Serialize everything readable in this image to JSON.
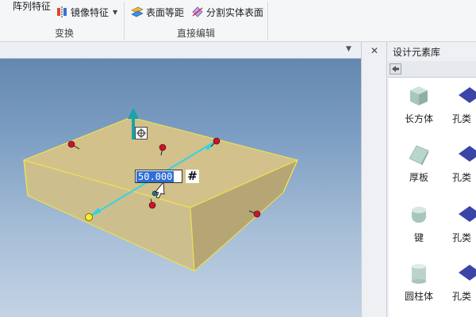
{
  "ribbon": {
    "transform_group": {
      "pattern_feature_label": "阵列特征",
      "mirror_feature_label": "镜像特征",
      "group_label": "变换"
    },
    "direct_edit_group": {
      "offset_surface_label": "表面等距",
      "split_solid_label": "分割实体表面",
      "group_label": "直接编辑"
    }
  },
  "viewport": {
    "dimension_value": "50.000",
    "lock_symbol": "#",
    "solid_color": "#d9c990",
    "edge_color": "#f2e64a",
    "dimension_color": "#33d2e6"
  },
  "library": {
    "title": "设计元素库",
    "items": [
      {
        "label": "长方体",
        "icon": "box-icon"
      },
      {
        "label": "厚板",
        "icon": "plate-icon"
      },
      {
        "label": "键",
        "icon": "key-icon"
      },
      {
        "label": "圆柱体",
        "icon": "cylinder-icon"
      }
    ],
    "partial_labels": [
      "孔类",
      "孔类",
      "孔类",
      "孔类"
    ]
  }
}
